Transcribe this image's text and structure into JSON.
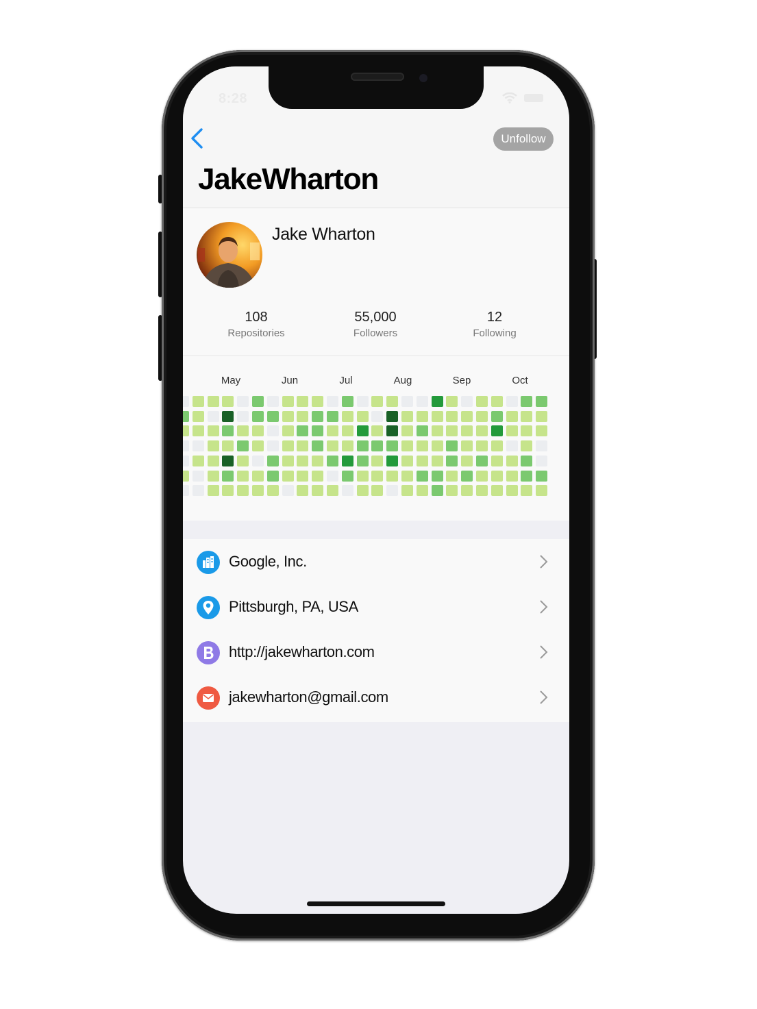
{
  "status_bar": {
    "time": "8:28"
  },
  "nav": {
    "unfollow_label": "Unfollow"
  },
  "profile": {
    "username": "JakeWharton",
    "full_name": "Jake Wharton",
    "stats": [
      {
        "value": "108",
        "label": "Repositories"
      },
      {
        "value": "55,000",
        "label": "Followers"
      },
      {
        "value": "12",
        "label": "Following"
      }
    ]
  },
  "contributions": {
    "months": [
      "May",
      "Jun",
      "Jul",
      "Aug",
      "Sep",
      "Oct"
    ],
    "colors": [
      "#ebedf0",
      "#c6e48b",
      "#7bc96f",
      "#239a3b",
      "#196127"
    ],
    "grid": [
      [
        0,
        1,
        1,
        1,
        0,
        2,
        0,
        1,
        1,
        1,
        0,
        2,
        0,
        1,
        1,
        0,
        0,
        3,
        1,
        0,
        1,
        1,
        0,
        2,
        2
      ],
      [
        2,
        1,
        0,
        4,
        0,
        2,
        2,
        1,
        1,
        2,
        2,
        1,
        1,
        0,
        4,
        1,
        1,
        1,
        1,
        1,
        1,
        2,
        1,
        1,
        1
      ],
      [
        1,
        1,
        1,
        2,
        1,
        1,
        0,
        1,
        2,
        2,
        1,
        1,
        3,
        1,
        4,
        1,
        2,
        1,
        1,
        1,
        1,
        3,
        1,
        1,
        1
      ],
      [
        0,
        0,
        1,
        1,
        2,
        1,
        0,
        1,
        1,
        2,
        1,
        1,
        2,
        2,
        2,
        1,
        1,
        1,
        2,
        1,
        1,
        1,
        0,
        1,
        0
      ],
      [
        0,
        1,
        1,
        4,
        1,
        0,
        2,
        1,
        1,
        1,
        2,
        3,
        2,
        1,
        3,
        1,
        1,
        1,
        2,
        1,
        2,
        1,
        1,
        2,
        0
      ],
      [
        1,
        0,
        1,
        2,
        1,
        1,
        2,
        1,
        1,
        1,
        0,
        2,
        1,
        1,
        1,
        1,
        2,
        2,
        1,
        2,
        1,
        1,
        1,
        2,
        2
      ],
      [
        0,
        0,
        1,
        1,
        1,
        1,
        1,
        0,
        1,
        1,
        1,
        0,
        1,
        1,
        0,
        1,
        1,
        2,
        1,
        1,
        1,
        1,
        1,
        1,
        1
      ]
    ]
  },
  "details": [
    {
      "text": "Google, Inc.",
      "icon": "company-icon",
      "color": "#1a9ae8"
    },
    {
      "text": "Pittsburgh, PA, USA",
      "icon": "location-pin-icon",
      "color": "#1a9ae8"
    },
    {
      "text": "http://jakewharton.com",
      "icon": "blog-icon",
      "color": "#8f7ae6"
    },
    {
      "text": "jakewharton@gmail.com",
      "icon": "email-icon",
      "color": "#ef5a42"
    }
  ]
}
